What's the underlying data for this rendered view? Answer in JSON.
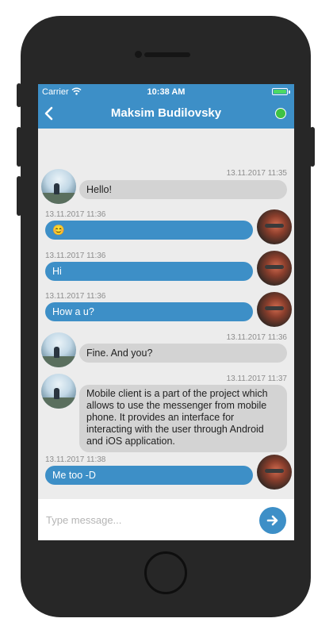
{
  "status_bar": {
    "carrier": "Carrier",
    "wifi_icon": "wifi-icon",
    "time": "10:38 AM",
    "battery_icon": "battery-icon",
    "battery_level": 1.0
  },
  "header": {
    "back_icon": "chevron-left-icon",
    "title": "Maksim Budilovsky",
    "status_indicator": "online"
  },
  "colors": {
    "accent": "#3d8fc7",
    "incoming_bubble": "#d3d3d3",
    "online": "#3fc243",
    "screen_background": "#ececec"
  },
  "messages": [
    {
      "side": "incoming",
      "time": "13.11.2017 11:35",
      "text": "Hello!"
    },
    {
      "side": "outgoing",
      "time": "13.11.2017 11:36",
      "text": "😊"
    },
    {
      "side": "outgoing",
      "time": "13.11.2017 11:36",
      "text": "Hi"
    },
    {
      "side": "outgoing",
      "time": "13.11.2017 11:36",
      "text": "How a u?"
    },
    {
      "side": "incoming",
      "time": "13.11.2017 11:36",
      "text": "Fine. And you?"
    },
    {
      "side": "incoming",
      "time": "13.11.2017 11:37",
      "text": "Mobile client is a part of the project which allows to use the messenger from mobile phone. It provides an interface for interacting with the user through Android and iOS application."
    },
    {
      "side": "outgoing",
      "time": "13.11.2017 11:38",
      "text": "Me too -D"
    }
  ],
  "composer": {
    "placeholder": "Type message...",
    "value": "",
    "send_icon": "arrow-right-icon"
  }
}
